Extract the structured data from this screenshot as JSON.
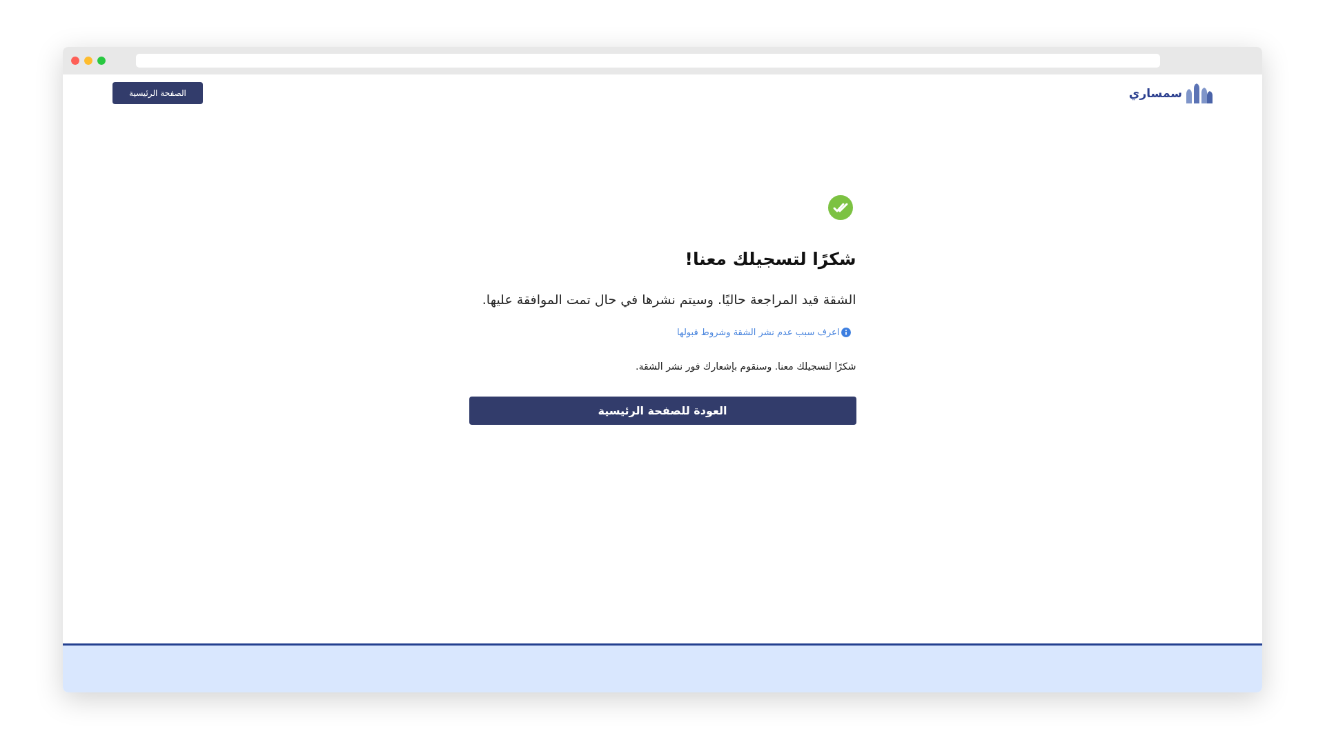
{
  "header": {
    "logo_text": "سمساري",
    "home_button": "الصفحة الرئيسية"
  },
  "confirmation": {
    "title": "شكرًا لتسجيلك معنا!",
    "message": "الشقة قيد المراجعة حاليًا. وسيتم نشرها في حال تمت الموافقة عليها.",
    "info_link": "اعرف سبب عدم نشر الشقة وشروط قبولها",
    "note": "شكرًا لتسجيلك معنا. وسنقوم بإشعارك فور نشر الشقة.",
    "back_button": "العودة للصفحة الرئيسية"
  }
}
